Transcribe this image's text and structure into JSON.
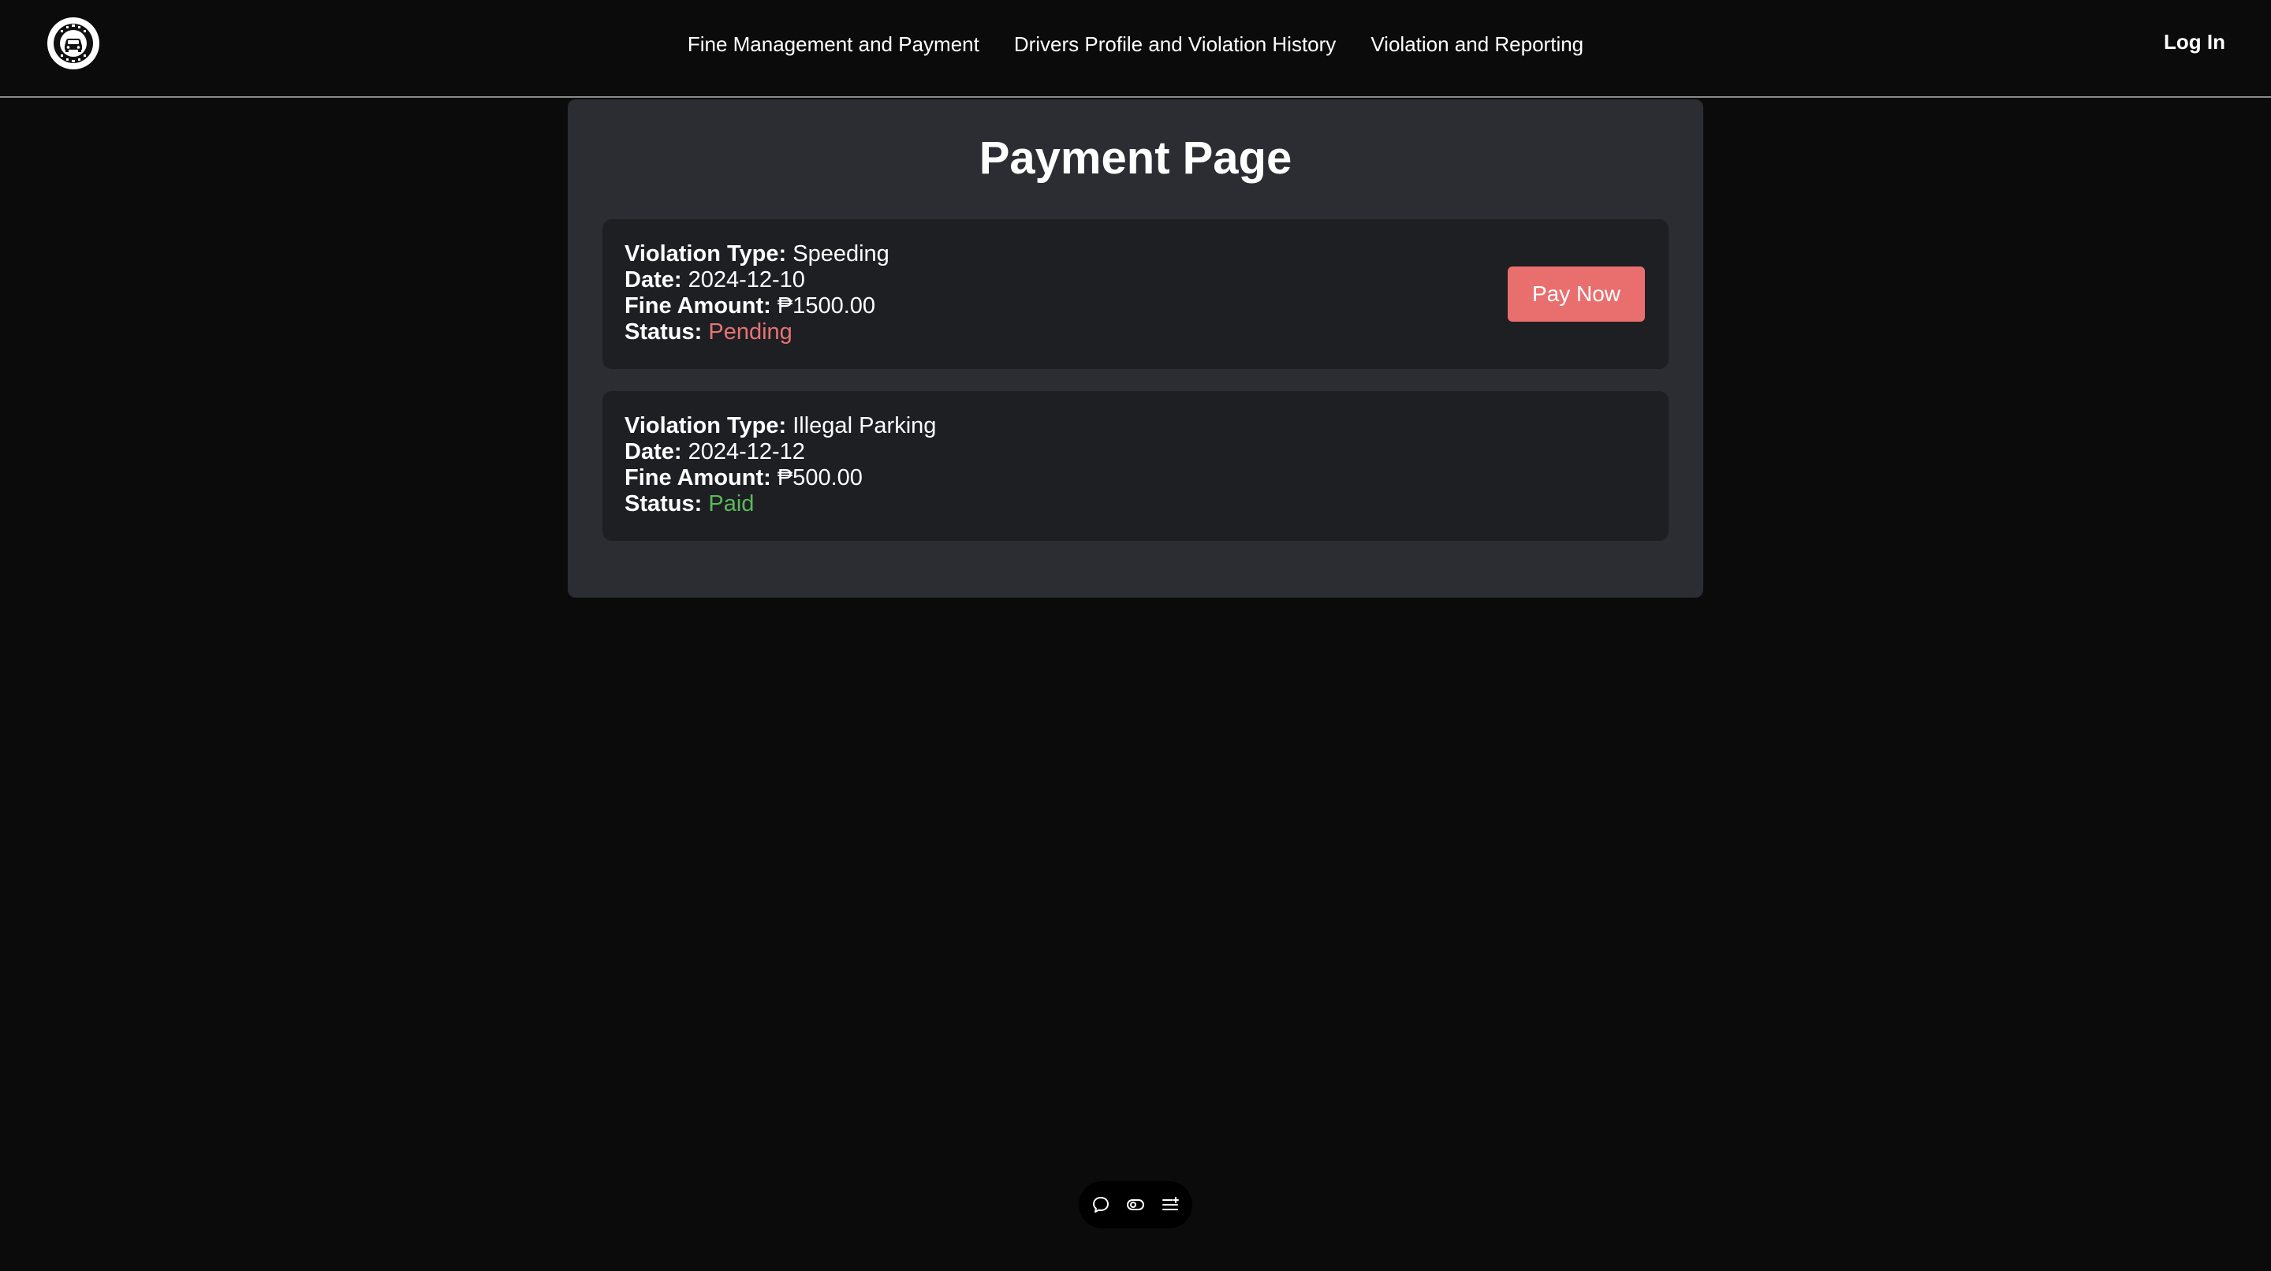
{
  "header": {
    "logo_icon": "traffic-enforcer-logo",
    "nav": [
      {
        "label": "Fine Management and Payment"
      },
      {
        "label": "Drivers Profile and Violation History"
      },
      {
        "label": "Violation and Reporting"
      }
    ],
    "login_label": "Log In"
  },
  "main": {
    "title": "Payment Page",
    "violations": [
      {
        "type_label": "Violation Type:",
        "type": "Speeding",
        "date_label": "Date:",
        "date": "2024-12-10",
        "amount_label": "Fine Amount:",
        "amount": "₱1500.00",
        "status_label": "Status:",
        "status": "Pending",
        "status_color": "#e57373",
        "action_label": "Pay Now"
      },
      {
        "type_label": "Violation Type:",
        "type": "Illegal Parking",
        "date_label": "Date:",
        "date": "2024-12-12",
        "amount_label": "Fine Amount:",
        "amount": "₱500.00",
        "status_label": "Status:",
        "status": "Paid",
        "status_color": "#5cb85c"
      }
    ]
  },
  "toolbar": {
    "icons": [
      "comment-icon",
      "toggle-view-icon",
      "list-menu-icon"
    ]
  },
  "colors": {
    "background": "#0b0b0b",
    "panel": "#2b2d33",
    "card": "#1e1f23",
    "accent_button": "#e96f6f"
  }
}
